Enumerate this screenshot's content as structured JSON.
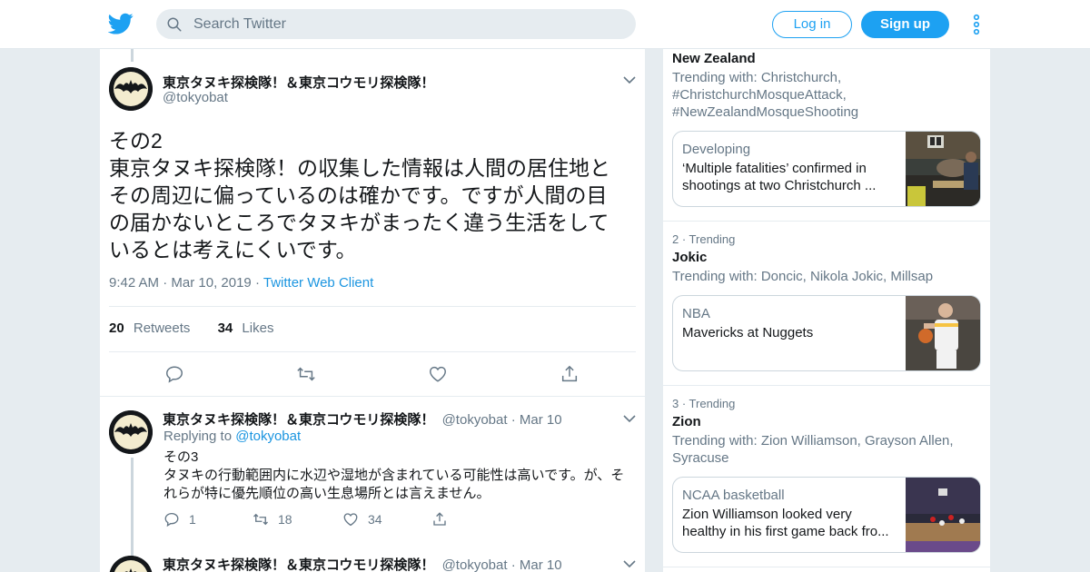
{
  "header": {
    "search_placeholder": "Search Twitter",
    "login_label": "Log in",
    "signup_label": "Sign up",
    "accent_color": "#1da1f2"
  },
  "main_tweet": {
    "display_name": "東京タヌキ探検隊！＆東京コウモリ探検隊！",
    "handle": "@tokyobat",
    "text_line1": "その2",
    "text_line2": "東京タヌキ探検隊！の収集した情報は人間の居住地と",
    "text_line3": "その周辺に偏っているのは確かです。ですが人間の目",
    "text_line4": "の届かないところでタヌキがまったく違う生活をして",
    "text_line5": "いるとは考えにくいです。",
    "time": "9:42 AM",
    "dot": "·",
    "date": "Mar 10, 2019",
    "client": "Twitter Web Client",
    "retweets_count": "20",
    "retweets_label": "Retweets",
    "likes_count": "34",
    "likes_label": "Likes"
  },
  "reply_tweets": [
    {
      "display_name": "東京タヌキ探検隊！＆東京コウモリ探検隊！",
      "handle": "@tokyobat",
      "dot": "·",
      "date": "Mar 10",
      "replying_to_label": "Replying to",
      "replying_to_handle": "@tokyobat",
      "text_line1": "その3",
      "text_line2": "タヌキの行動範囲内に水辺や湿地が含まれている可能性は高いです。が、そ",
      "text_line3": "れらが特に優先順位の高い生息場所とは言えません。",
      "reply_count": "1",
      "retweet_count": "18",
      "like_count": "34"
    },
    {
      "display_name": "東京タヌキ探検隊！＆東京コウモリ探検隊！",
      "handle": "@tokyobat",
      "dot": "·",
      "date": "Mar 10"
    }
  ],
  "trends": [
    {
      "title": "New Zealand",
      "with_line1": "Trending with: Christchurch,",
      "with_line2": "#ChristchurchMosqueAttack,",
      "with_line3": "#NewZealandMosqueShooting",
      "card_category": "Developing",
      "card_text_line1": "‘Multiple fatalities’ confirmed in",
      "card_text_line2": "shootings at two Christchurch ..."
    },
    {
      "label": "2 · Trending",
      "title": "Jokic",
      "with_line1": "Trending with: Doncic, Nikola Jokic, Millsap",
      "card_category": "NBA",
      "card_text_line1": "Mavericks at Nuggets"
    },
    {
      "label": "3 · Trending",
      "title": "Zion",
      "with_line1": "Trending with: Zion Williamson, Grayson Allen,",
      "with_line2": "Syracuse",
      "card_category": "NCAA basketball",
      "card_text_line1": "Zion Williamson looked very",
      "card_text_line2": "healthy in his first game back fro..."
    }
  ]
}
